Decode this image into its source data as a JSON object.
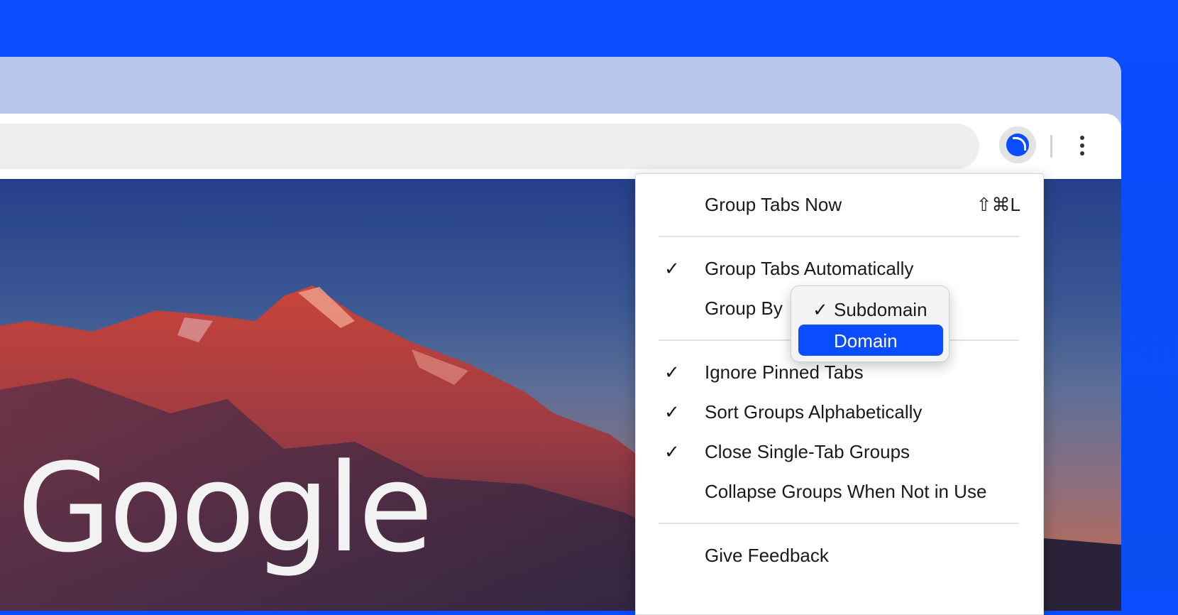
{
  "toolbar": {
    "extension_icon": "tab-grouper-extension-icon",
    "more_icon": "more-vertical-icon"
  },
  "page": {
    "logo_text": "Google"
  },
  "menu": {
    "group_tabs_now": {
      "label": "Group Tabs Now",
      "shortcut": "⇧⌘L"
    },
    "group_tabs_automatically": {
      "label": "Group Tabs Automatically",
      "checked": true
    },
    "group_by": {
      "label": "Group By"
    },
    "ignore_pinned_tabs": {
      "label": "Ignore Pinned Tabs",
      "checked": true
    },
    "sort_groups_alphabetically": {
      "label": "Sort Groups Alphabetically",
      "checked": true
    },
    "close_single_tab_groups": {
      "label": "Close Single-Tab Groups",
      "checked": true
    },
    "collapse_groups": {
      "label": "Collapse Groups When Not in Use",
      "checked": false
    },
    "give_feedback": {
      "label": "Give Feedback"
    },
    "check_mark": "✓"
  },
  "group_by_popup": {
    "options": [
      {
        "label": "Subdomain",
        "checked": true,
        "highlighted": false
      },
      {
        "label": "Domain",
        "checked": false,
        "highlighted": true
      }
    ],
    "check_mark": "✓",
    "highlight_color": "#0a4cff"
  },
  "colors": {
    "background": "#0a4cff",
    "accent": "#0a4cff"
  }
}
